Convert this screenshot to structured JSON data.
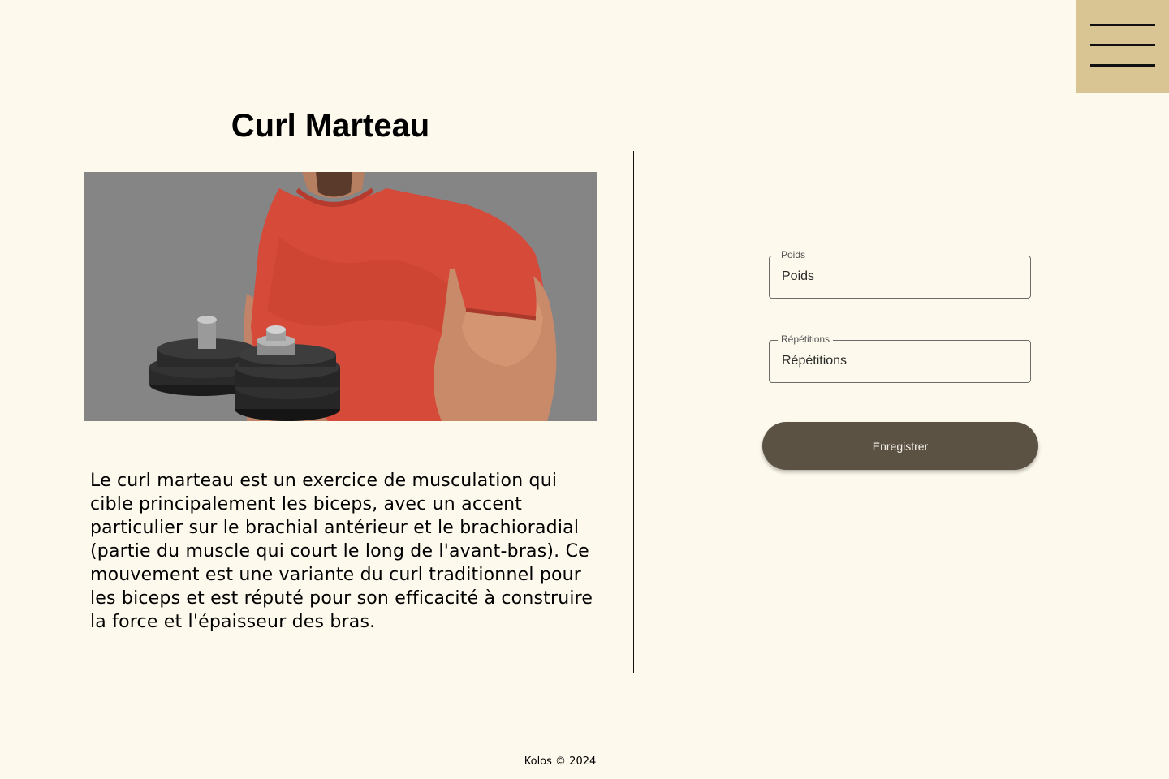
{
  "menu": {
    "icon": "hamburger-menu-icon"
  },
  "exercise": {
    "title": "Curl Marteau",
    "description": "Le curl marteau est un exercice de musculation qui cible principalement les biceps, avec un accent particulier sur le brachial antérieur et le brachioradial (partie du muscle qui court le long de l'avant-bras). Ce mouvement est une variante du curl traditionnel pour les biceps et est réputé pour son efficacité à construire la force et l'épaisseur des bras."
  },
  "form": {
    "weight": {
      "label": "Poids",
      "placeholder": "Poids",
      "value": ""
    },
    "reps": {
      "label": "Répétitions",
      "placeholder": "Répétitions",
      "value": ""
    },
    "save_label": "Enregistrer"
  },
  "footer": {
    "text": "Kolos © 2024"
  },
  "colors": {
    "background": "#fdf9ec",
    "menu_block": "#d9c594",
    "button": "#5c5244",
    "photo_background": "#858585",
    "shirt": "#d64a3a"
  }
}
